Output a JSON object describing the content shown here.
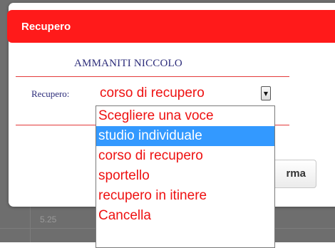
{
  "background": {
    "cell_text": "5.25"
  },
  "dialog": {
    "title": "Recupero",
    "student_name": "AMMANITI NICCOLO",
    "field_label": "Recupero:",
    "select_value": "corso di recupero",
    "confirm_label": "rma",
    "header_color": "#ff1a1a"
  },
  "dropdown": {
    "options": [
      {
        "label": "Scegliere una voce",
        "selected": false
      },
      {
        "label": "studio individuale",
        "selected": true
      },
      {
        "label": "corso di recupero",
        "selected": false
      },
      {
        "label": "sportello",
        "selected": false
      },
      {
        "label": "recupero in itinere",
        "selected": false
      },
      {
        "label": "Cancella",
        "selected": false
      }
    ],
    "highlight_color": "#3399ff",
    "text_color": "#ee1111"
  }
}
